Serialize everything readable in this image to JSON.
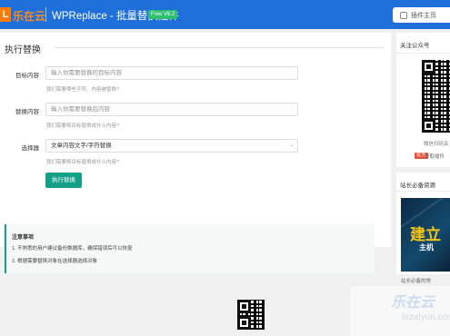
{
  "header": {
    "logo_icon": "L",
    "brand": "乐在云",
    "title": "WPReplace - 批量替换插件",
    "version_badge": "Free V6.2",
    "ext_button": "插件主页",
    "colors": {
      "bar": "#1e6fd9",
      "brand": "#ff8c1a",
      "badge": "#2fbf71"
    }
  },
  "main": {
    "section_title": "执行替换",
    "fields": [
      {
        "label": "目标内容",
        "placeholder": "输入你需要替换的目标内容",
        "hint": "我们需要哪些字符、内容被替换?"
      },
      {
        "label": "替换内容",
        "placeholder": "输入你需要替换后内容",
        "hint": "我们需要将目标替换成什么内容?"
      },
      {
        "label": "选择器",
        "value": "文章内容文字/字符替换",
        "hint": "我们需要将目标替换成什么内容?",
        "icon": "chevron-down-icon"
      }
    ],
    "run_button": "执行替换",
    "run_button_color": "#12a087",
    "notice": {
      "title": "注意事项",
      "items": [
        "1. 不熟悉的用户建议备份数据库，确保错误后可以恢复",
        "2. 根据需要替换对象在选择器选择对象"
      ]
    }
  },
  "sidebar": {
    "follow_title": "关注公众号",
    "qr_icon": "qr-code-icon",
    "qr_caption": "微信扫码关",
    "qr_tag": "优先",
    "qr_note": "获取插件",
    "tips_title": "站长必备资源",
    "banner_big": "建立",
    "banner_sub": "主机",
    "banner_caption": "站长必备的常"
  },
  "watermark": {
    "line1": "乐在云",
    "line2": "lezaiyun.com"
  }
}
